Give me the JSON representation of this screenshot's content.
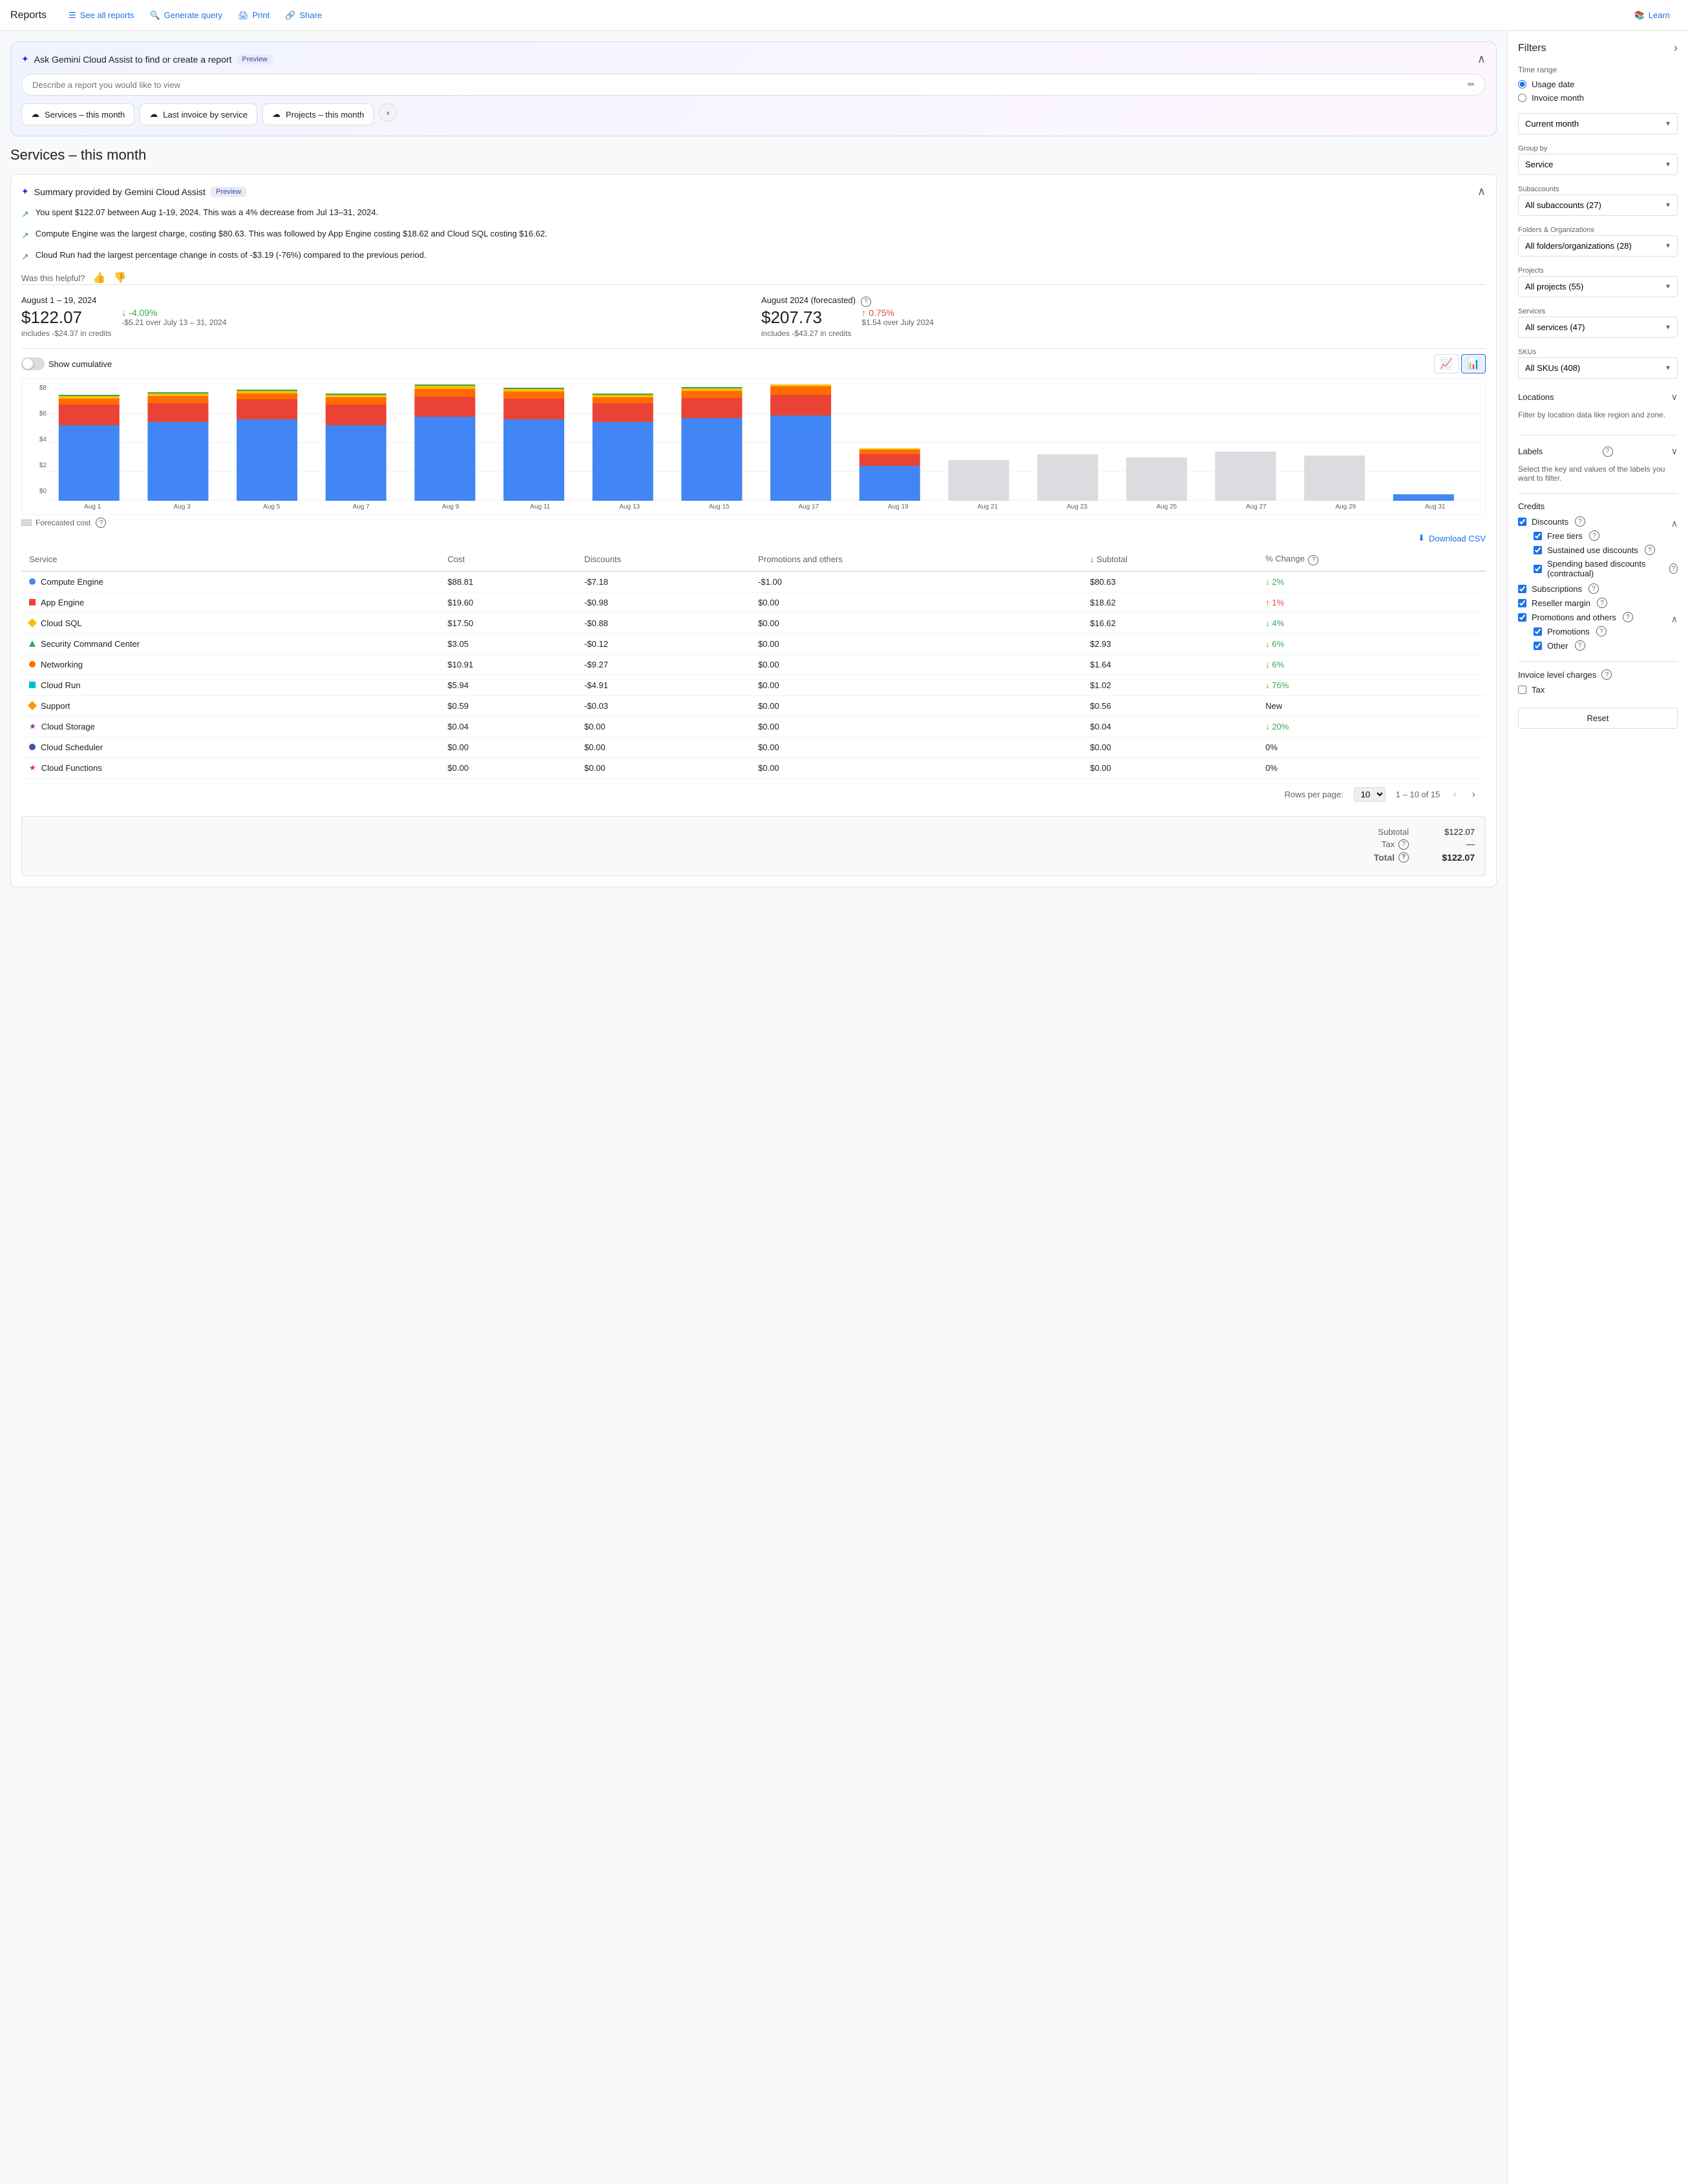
{
  "header": {
    "title": "Reports",
    "nav": [
      {
        "id": "see-all-reports",
        "label": "See all reports",
        "icon": "☰"
      },
      {
        "id": "generate-query",
        "label": "Generate query",
        "icon": "🔍"
      },
      {
        "id": "print",
        "label": "Print",
        "icon": "🖨"
      },
      {
        "id": "share",
        "label": "Share",
        "icon": "🔗"
      }
    ],
    "learn_label": "Learn",
    "learn_icon": "📚"
  },
  "gemini": {
    "title": "Ask Gemini Cloud Assist to find or create a report",
    "preview_badge": "Preview",
    "input_placeholder": "Describe a report you would like to view",
    "chips": [
      {
        "label": "Services – this month",
        "icon": "☁"
      },
      {
        "label": "Last invoice by service",
        "icon": "☁"
      },
      {
        "label": "Projects – this month",
        "icon": "☁"
      }
    ]
  },
  "page_title": "Services – this month",
  "summary": {
    "title": "Summary provided by Gemini Cloud Assist",
    "preview_badge": "Preview",
    "items": [
      "You spent $122.07 between Aug 1-19, 2024. This was a 4% decrease from Jul 13–31, 2024.",
      "Compute Engine was the largest charge, costing $80.63. This was followed by App Engine costing $18.62 and Cloud SQL costing $16.62.",
      "Cloud Run had the largest percentage change in costs of -$3.19 (-76%) compared to the previous period."
    ],
    "helpful_label": "Was this helpful?"
  },
  "metrics": {
    "current": {
      "period": "August 1 – 19, 2024",
      "amount": "$122.07",
      "sub": "includes -$24.37 in credits",
      "change": "↓ -4.09%",
      "change_type": "down",
      "change_sub": "-$5.21 over July 13 – 31, 2024"
    },
    "forecasted": {
      "period": "August 2024 (forecasted)",
      "amount": "$207.73",
      "sub": "includes -$43.27 in credits",
      "change": "↑ 0.75%",
      "change_type": "up",
      "change_sub": "$1.54 over July 2024"
    }
  },
  "chart": {
    "show_cumulative_label": "Show cumulative",
    "y_labels": [
      "$8",
      "$6",
      "$4",
      "$2",
      "$0"
    ],
    "x_labels": [
      "Aug 1",
      "Aug 3",
      "Aug 5",
      "Aug 7",
      "Aug 9",
      "Aug 11",
      "Aug 13",
      "Aug 15",
      "Aug 17",
      "Aug 19",
      "Aug 21",
      "Aug 23",
      "Aug 25",
      "Aug 27",
      "Aug 29",
      "Aug 31"
    ],
    "forecasted_label": "Forecasted cost",
    "bars": [
      {
        "blue": 65,
        "orange": 18,
        "red": 5,
        "yellow": 2,
        "green": 1
      },
      {
        "blue": 68,
        "orange": 16,
        "red": 6,
        "yellow": 2,
        "green": 1
      },
      {
        "blue": 70,
        "orange": 17,
        "red": 5,
        "yellow": 2,
        "green": 1
      },
      {
        "blue": 65,
        "orange": 18,
        "red": 6,
        "yellow": 2,
        "green": 1
      },
      {
        "blue": 72,
        "orange": 17,
        "red": 7,
        "yellow": 3,
        "green": 1
      },
      {
        "blue": 70,
        "orange": 18,
        "red": 6,
        "yellow": 2,
        "green": 1
      },
      {
        "blue": 68,
        "orange": 16,
        "red": 5,
        "yellow": 2,
        "green": 1
      },
      {
        "blue": 71,
        "orange": 17,
        "red": 6,
        "yellow": 2,
        "green": 1
      },
      {
        "blue": 73,
        "orange": 18,
        "red": 7,
        "yellow": 3,
        "green": 1
      },
      {
        "blue": 30,
        "orange": 10,
        "red": 4,
        "yellow": 1,
        "green": 1
      },
      {
        "blue": 35,
        "orange": 0,
        "red": 0,
        "yellow": 0,
        "green": 0
      },
      {
        "blue": 40,
        "orange": 0,
        "red": 0,
        "yellow": 0,
        "green": 0
      },
      {
        "blue": 38,
        "orange": 0,
        "red": 0,
        "yellow": 0,
        "green": 0
      },
      {
        "blue": 42,
        "orange": 0,
        "red": 0,
        "yellow": 0,
        "green": 0
      },
      {
        "blue": 39,
        "orange": 0,
        "red": 0,
        "yellow": 0,
        "green": 0
      },
      {
        "blue": 5,
        "orange": 0,
        "red": 0,
        "yellow": 0,
        "green": 0
      }
    ]
  },
  "table": {
    "download_csv_label": "Download CSV",
    "columns": [
      "Service",
      "Cost",
      "Discounts",
      "Promotions and others",
      "Subtotal",
      "% Change"
    ],
    "rows": [
      {
        "service": "Compute Engine",
        "color": "#4285f4",
        "shape": "dot",
        "cost": "$88.81",
        "discounts": "-$7.18",
        "promotions": "-$1.00",
        "subtotal": "$80.63",
        "change": "↓ 2%",
        "change_type": "down"
      },
      {
        "service": "App Engine",
        "color": "#ea4335",
        "shape": "square",
        "cost": "$19.60",
        "discounts": "-$0.98",
        "promotions": "$0.00",
        "subtotal": "$18.62",
        "change": "↑ 1%",
        "change_type": "up"
      },
      {
        "service": "Cloud SQL",
        "color": "#fbbc04",
        "shape": "diamond",
        "cost": "$17.50",
        "discounts": "-$0.88",
        "promotions": "$0.00",
        "subtotal": "$16.62",
        "change": "↓ 4%",
        "change_type": "down"
      },
      {
        "service": "Security Command Center",
        "color": "#34a853",
        "shape": "triangle",
        "cost": "$3.05",
        "discounts": "-$0.12",
        "promotions": "$0.00",
        "subtotal": "$2.93",
        "change": "↓ 6%",
        "change_type": "down"
      },
      {
        "service": "Networking",
        "color": "#ff6d00",
        "shape": "dot",
        "cost": "$10.91",
        "discounts": "-$9.27",
        "promotions": "$0.00",
        "subtotal": "$1.64",
        "change": "↓ 6%",
        "change_type": "down"
      },
      {
        "service": "Cloud Run",
        "color": "#00bcd4",
        "shape": "square",
        "cost": "$5.94",
        "discounts": "-$4.91",
        "promotions": "$0.00",
        "subtotal": "$1.02",
        "change": "↓ 76%",
        "change_type": "down"
      },
      {
        "service": "Support",
        "color": "#ff9800",
        "shape": "diamond",
        "cost": "$0.59",
        "discounts": "-$0.03",
        "promotions": "$0.00",
        "subtotal": "$0.56",
        "change": "New",
        "change_type": "new"
      },
      {
        "service": "Cloud Storage",
        "color": "#9c27b0",
        "shape": "star",
        "cost": "$0.04",
        "discounts": "$0.00",
        "promotions": "$0.00",
        "subtotal": "$0.04",
        "change": "↓ 20%",
        "change_type": "down"
      },
      {
        "service": "Cloud Scheduler",
        "color": "#3f51b5",
        "shape": "dot",
        "cost": "$0.00",
        "discounts": "$0.00",
        "promotions": "$0.00",
        "subtotal": "$0.00",
        "change": "0%",
        "change_type": "neutral"
      },
      {
        "service": "Cloud Functions",
        "color": "#e91e63",
        "shape": "star",
        "cost": "$0.00",
        "discounts": "$0.00",
        "promotions": "$0.00",
        "subtotal": "$0.00",
        "change": "0%",
        "change_type": "neutral"
      }
    ],
    "pagination": {
      "rows_per_page_label": "Rows per page:",
      "rows_per_page": "10",
      "range": "1 – 10 of 15"
    },
    "totals": {
      "subtotal_label": "Subtotal",
      "subtotal_value": "$122.07",
      "tax_label": "Tax",
      "tax_help": true,
      "tax_value": "—",
      "total_label": "Total",
      "total_help": true,
      "total_value": "$122.07"
    }
  },
  "filters": {
    "title": "Filters",
    "time_range": {
      "label": "Time range",
      "options": [
        {
          "id": "usage_date",
          "label": "Usage date",
          "checked": true
        },
        {
          "id": "invoice_month",
          "label": "Invoice month",
          "checked": false
        }
      ],
      "selected_period": "Current month"
    },
    "group_by": {
      "label": "Group by",
      "value": "Service"
    },
    "subaccounts": {
      "label": "Subaccounts",
      "value": "All subaccounts (27)"
    },
    "folders": {
      "label": "Folders & Organizations",
      "value": "All folders/organizations (28)"
    },
    "projects": {
      "label": "Projects",
      "value": "All projects (55)"
    },
    "services": {
      "label": "Services",
      "value": "All services (47)"
    },
    "skus": {
      "label": "SKUs",
      "value": "All SKUs (408)"
    },
    "locations": {
      "label": "Locations",
      "description": "Filter by location data like region and zone."
    },
    "labels": {
      "label": "Labels",
      "description": "Select the key and values of the labels you want to filter."
    },
    "credits": {
      "label": "Credits",
      "discounts": {
        "label": "Discounts",
        "expanded": true,
        "items": [
          {
            "label": "Free tiers",
            "checked": true
          },
          {
            "label": "Sustained use discounts",
            "checked": true
          },
          {
            "label": "Spending based discounts (contractual)",
            "checked": true
          }
        ]
      },
      "subscriptions": {
        "label": "Subscriptions",
        "checked": true
      },
      "reseller_margin": {
        "label": "Reseller margin",
        "checked": true
      },
      "promotions_others": {
        "label": "Promotions and others",
        "expanded": true,
        "items": [
          {
            "label": "Promotions",
            "checked": true
          },
          {
            "label": "Other",
            "checked": true
          }
        ]
      }
    },
    "invoice_level": {
      "label": "Invoice level charges",
      "items": [
        {
          "label": "Tax",
          "checked": false
        }
      ]
    },
    "reset_label": "Reset"
  }
}
